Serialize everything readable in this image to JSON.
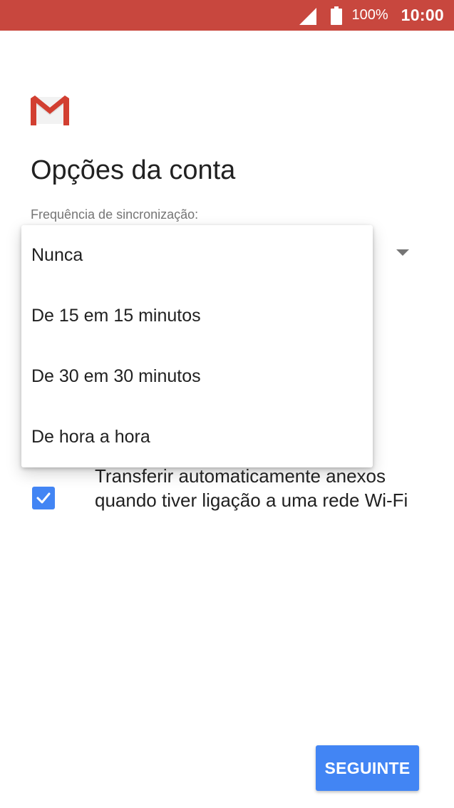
{
  "status_bar": {
    "battery_percent": "100%",
    "time": "10:00",
    "icons": [
      "signal-icon",
      "battery-icon"
    ],
    "background_color": "#c8473e"
  },
  "header": {
    "logo_icon": "gmail-logo-icon",
    "title": "Opções da conta"
  },
  "sync": {
    "label": "Frequência de sincronização:",
    "options": [
      "Nunca",
      "De 15 em 15 minutos",
      "De 30 em 30 minutos",
      "De hora a hora"
    ]
  },
  "attachments": {
    "checked": true,
    "label": "Transferir automaticamente anexos quando tiver ligação a uma rede Wi-Fi"
  },
  "footer": {
    "next_label": "SEGUINTE"
  },
  "colors": {
    "accent": "#4285f4",
    "status_bar": "#c8473e",
    "text_primary": "#212121",
    "text_secondary": "#757575"
  }
}
